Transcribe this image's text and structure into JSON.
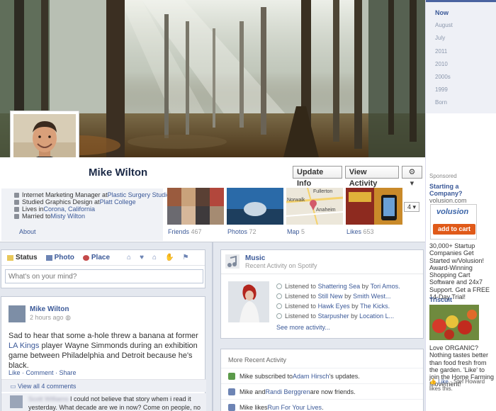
{
  "profile": {
    "name": "Mike Wilton",
    "about": [
      {
        "text": "Internet Marketing Manager at ",
        "link": "Plastic Surgery Studios"
      },
      {
        "text": "Studied Graphics Design at ",
        "link": "Platt College"
      },
      {
        "text": "Lives in ",
        "link": "Corona, California"
      },
      {
        "text": "Married to ",
        "link": "Misty Wilton"
      }
    ],
    "about_link": "About",
    "buttons": {
      "update_info": "Update Info",
      "view_activity": "View Activity",
      "gear": "⚙ ▾"
    }
  },
  "tiles": [
    {
      "label": "Friends",
      "count": "467"
    },
    {
      "label": "Photos",
      "count": "72"
    },
    {
      "label": "Map",
      "count": "5"
    },
    {
      "label": "Likes",
      "count": "653"
    }
  ],
  "map_labels": {
    "place1": "Fullerton",
    "place2": "Norwalk",
    "place3": "Anaheim"
  },
  "more_tiles": "4 ▾",
  "composer": {
    "tabs": [
      "Status",
      "Photo",
      "Place"
    ],
    "placeholder": "What's on your mind?"
  },
  "post": {
    "author": "Mike Wilton",
    "time": "2 hours ago",
    "text_a": "Sad to hear that some a-hole threw a banana at former ",
    "text_link": "LA Kings",
    "text_b": " player Wayne Simmonds during an exhibition game between Philadelphia and Detroit because he's black.",
    "actions": "Like · Comment · Share",
    "view_comments": "View all 4 comments",
    "comment_author": "Scott Williams",
    "comment_text": "I could not believe that story whem i read it yesterday. What decade are we in now? Come on people, no need"
  },
  "music": {
    "title": "Music",
    "subtitle": "Recent Activity on Spotify",
    "tracks": [
      {
        "song": "Shattering Sea",
        "artist": "Tori Amos."
      },
      {
        "song": "Still New",
        "artist": "Smith West..."
      },
      {
        "song": "Hawk Eyes",
        "artist": "The Kicks."
      },
      {
        "song": "Starpusher",
        "artist": "Location L..."
      }
    ],
    "listened_prefix": "Listened to",
    "by": "by",
    "see_more": "See more activity..."
  },
  "recent": {
    "heading": "More Recent Activity",
    "items": [
      {
        "pre": "Mike subscribed to ",
        "link": "Adam Hirsch",
        "post": "'s updates."
      },
      {
        "pre": "Mike and ",
        "link": "Randi Berggren",
        "post": " are now friends."
      },
      {
        "pre": "Mike likes ",
        "link": "Run For Your Lives",
        "post": "."
      }
    ]
  },
  "timeline_nav": [
    "Now",
    "August",
    "July",
    "2011",
    "2010",
    "2000s",
    "1999",
    "Born"
  ],
  "ads": {
    "sponsored": "Sponsored",
    "ad1": {
      "title": "Starting a Company?",
      "url": "volusion.com",
      "logo": "volusion",
      "cta": "add to cart",
      "body": "30,000+ Startup Companies Get Started w/Volusion! Award-Winning Shopping Cart Software and 24x7 Support. Get a FREE 14-Day Trial!"
    },
    "ad2": {
      "title": "Triscuit",
      "body": "Love ORGANIC? Nothing tastes better than food fresh from the garden. 'Like' to join the Home Farming Movement!",
      "like": "Like",
      "social": "Stef Howard likes this."
    }
  },
  "colors": {
    "brand": "#3b5998",
    "cta": "#e05a19"
  }
}
